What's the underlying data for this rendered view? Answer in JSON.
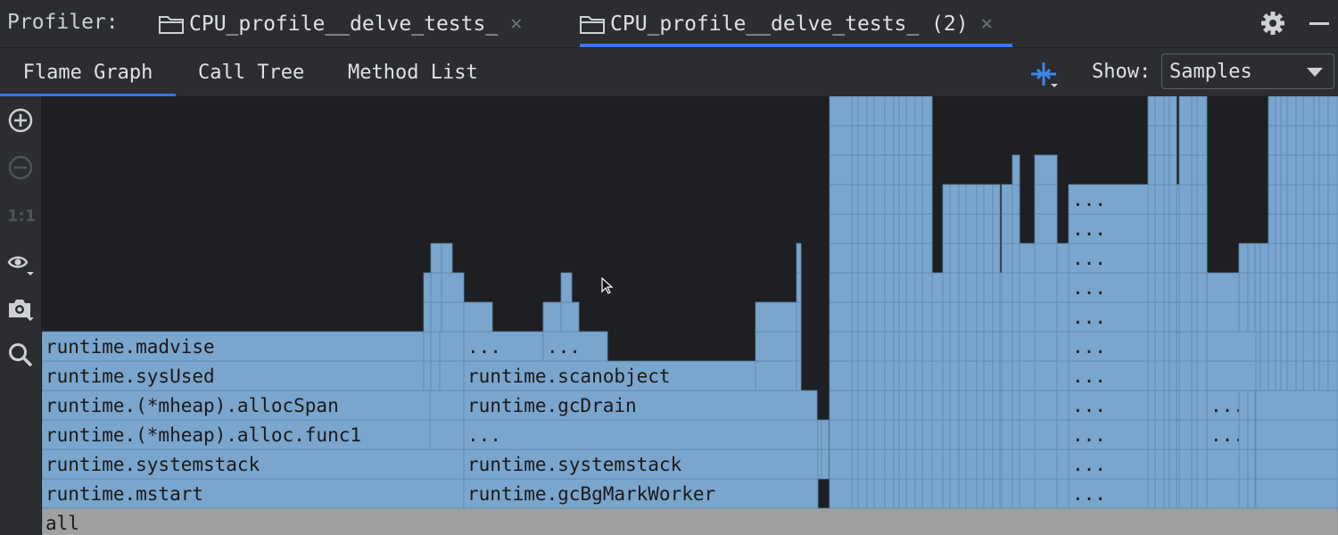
{
  "header": {
    "profiler_label": "Profiler:",
    "tabs": [
      {
        "label": "CPU_profile__delve_tests_",
        "active": false
      },
      {
        "label": "CPU_profile__delve_tests_ (2)",
        "active": true
      }
    ],
    "close_glyph": "✕"
  },
  "view_tabs": [
    {
      "label": "Flame Graph",
      "active": true
    },
    {
      "label": "Call Tree",
      "active": false
    },
    {
      "label": "Method List",
      "active": false
    }
  ],
  "show": {
    "label": "Show:",
    "value": "Samples"
  },
  "sidebar": {
    "icons": [
      "zoom-in-icon",
      "zoom-out-icon",
      "actual-size-icon",
      "eye-icon",
      "camera-icon",
      "search-icon"
    ],
    "actual_size_text": "1:1"
  },
  "flame_graph": {
    "frames": [
      {
        "label": "all"
      },
      {
        "label": "runtime.mstart"
      },
      {
        "label": "runtime.systemstack"
      },
      {
        "label": "runtime.(*mheap).alloc.func1"
      },
      {
        "label": "runtime.(*mheap).allocSpan"
      },
      {
        "label": "runtime.sysUsed"
      },
      {
        "label": "runtime.madvise"
      },
      {
        "label": "runtime.gcBgMarkWorker"
      },
      {
        "label": "runtime.systemstack"
      },
      {
        "label": "..."
      },
      {
        "label": "runtime.gcDrain"
      },
      {
        "label": "runtime.scanobject"
      },
      {
        "label": "..."
      }
    ]
  },
  "colors": {
    "frame": "#7aa5cc",
    "frame_border": "#5e88ad",
    "root": "#a0a0a0",
    "background": "#1e1f22",
    "accent": "#3574f0"
  }
}
